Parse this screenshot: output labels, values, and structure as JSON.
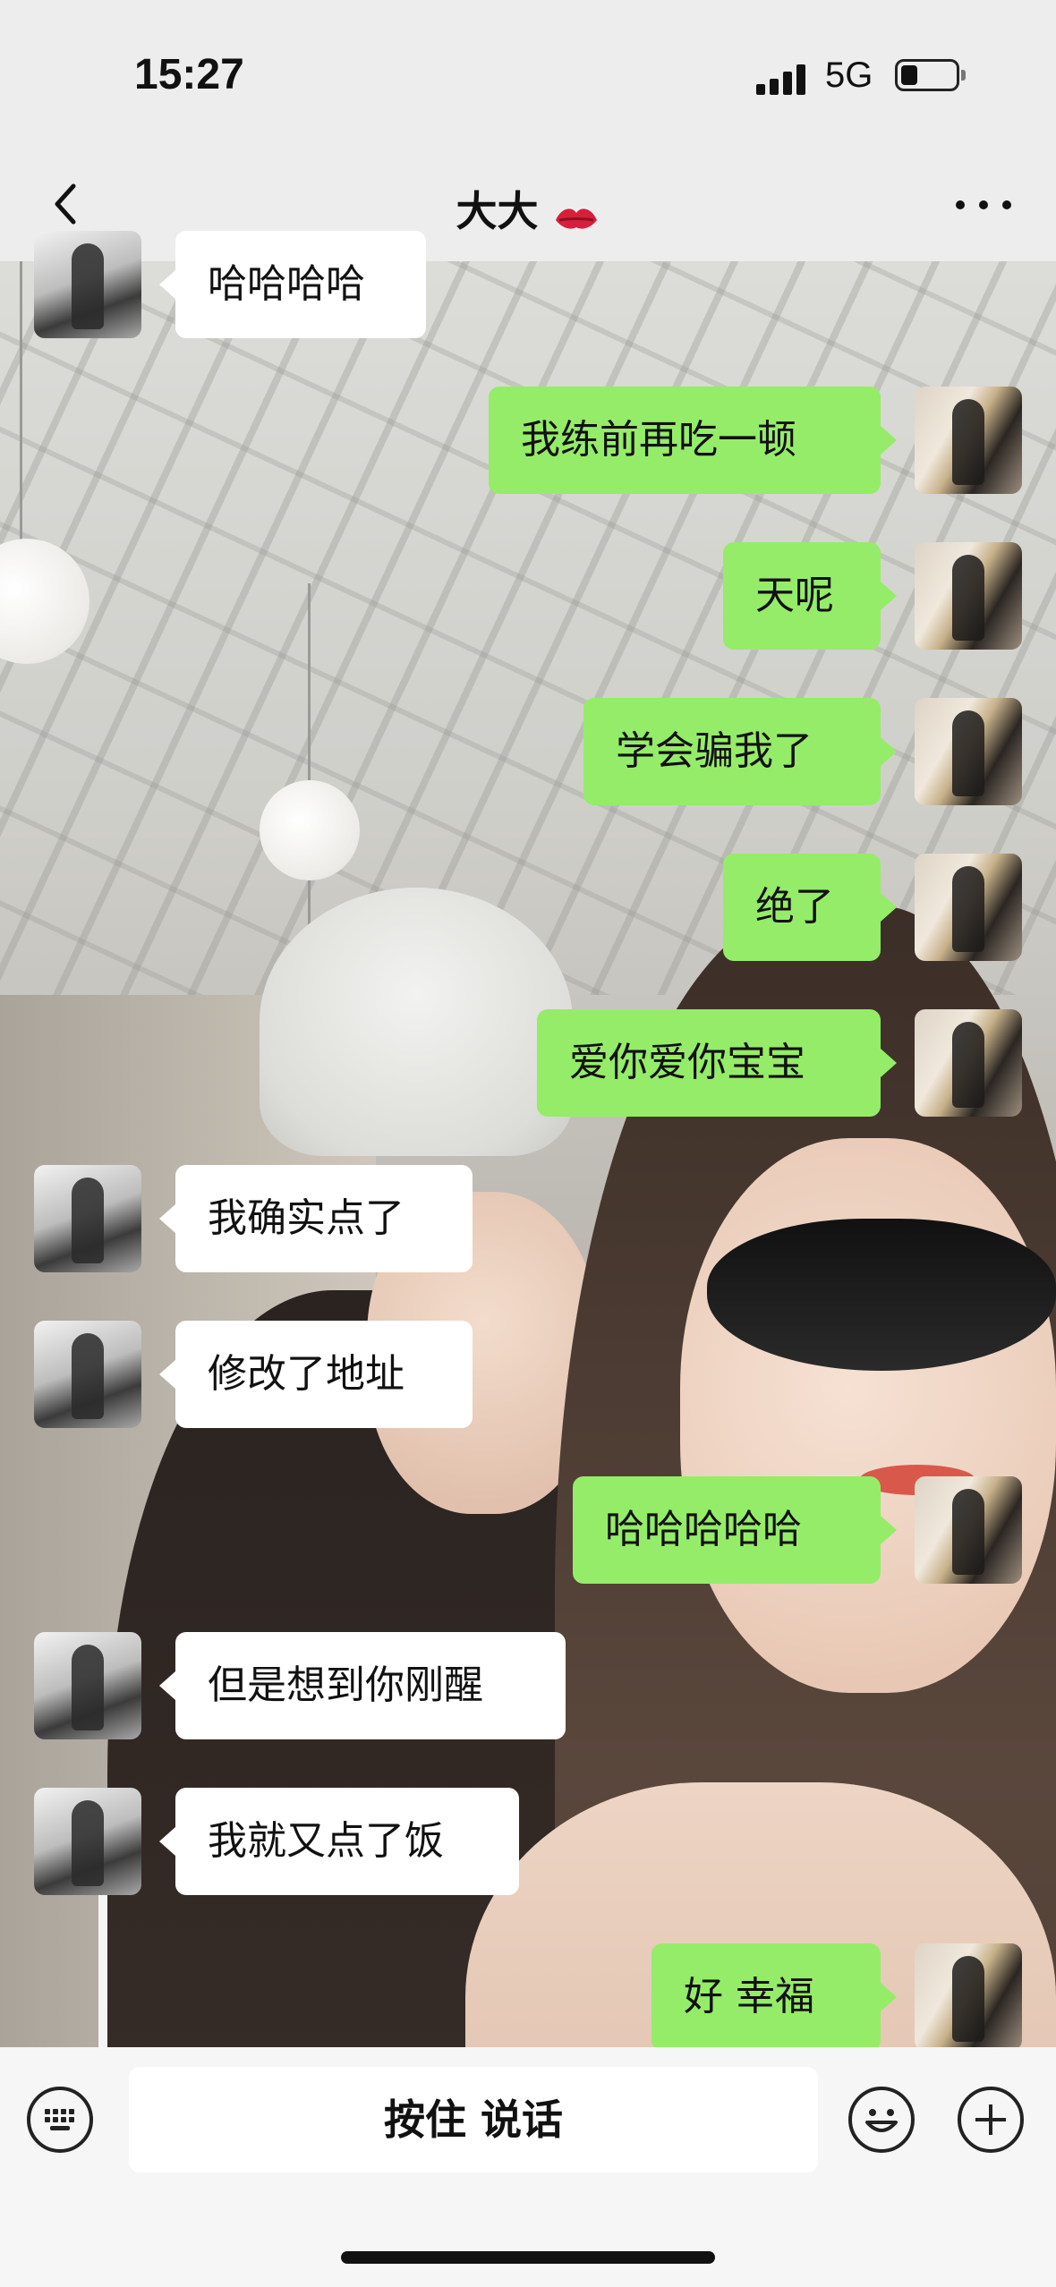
{
  "status_bar": {
    "time": "15:27",
    "network": "5G"
  },
  "header": {
    "title": "大大"
  },
  "messages": [
    {
      "side": "received",
      "text": "哈哈哈哈"
    },
    {
      "side": "sent",
      "text": "我练前再吃一顿"
    },
    {
      "side": "sent",
      "text": "天呢"
    },
    {
      "side": "sent",
      "text": "学会骗我了"
    },
    {
      "side": "sent",
      "text": "绝了"
    },
    {
      "side": "sent",
      "text": "爱你爱你宝宝"
    },
    {
      "side": "received",
      "text": "我确实点了"
    },
    {
      "side": "received",
      "text": "修改了地址"
    },
    {
      "side": "sent",
      "text": "哈哈哈哈哈"
    },
    {
      "side": "received",
      "text": "但是想到你刚醒"
    },
    {
      "side": "received",
      "text": "我就又点了饭"
    },
    {
      "side": "sent",
      "text": "好 幸福"
    }
  ],
  "input_bar": {
    "hold_to_talk_label": "按住 说话"
  },
  "colors": {
    "sent_bubble": "#95ec69",
    "received_bubble": "#ffffff",
    "bar_background": "#ededed"
  }
}
